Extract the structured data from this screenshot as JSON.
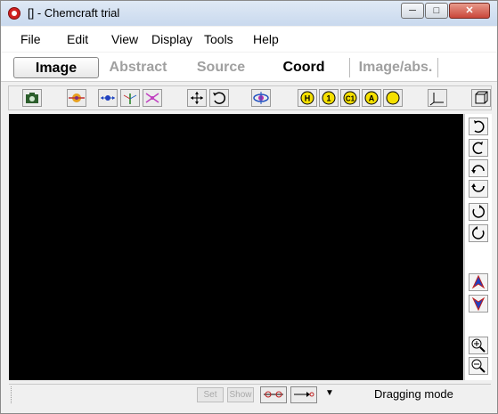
{
  "window": {
    "title": "[] - Chemcraft trial",
    "minimize": "─",
    "maximize": "□",
    "close": "✕"
  },
  "menu": [
    "File",
    "Edit",
    "View",
    "Display",
    "Tools",
    "Help"
  ],
  "tabs": [
    {
      "label": "Image",
      "state": "active"
    },
    {
      "label": "Abstract",
      "state": "disabled"
    },
    {
      "label": "Source",
      "state": "disabled"
    },
    {
      "label": "Coord",
      "state": "normal"
    },
    {
      "label": "Image/abs.",
      "state": "disabled"
    }
  ],
  "toolbar": {
    "atom_labels": [
      "H",
      "1",
      "C1",
      "A"
    ]
  },
  "statusbar": {
    "set_label": "Set",
    "show_label": "Show",
    "dropdown": "▼",
    "mode_text": "Dragging mode"
  }
}
